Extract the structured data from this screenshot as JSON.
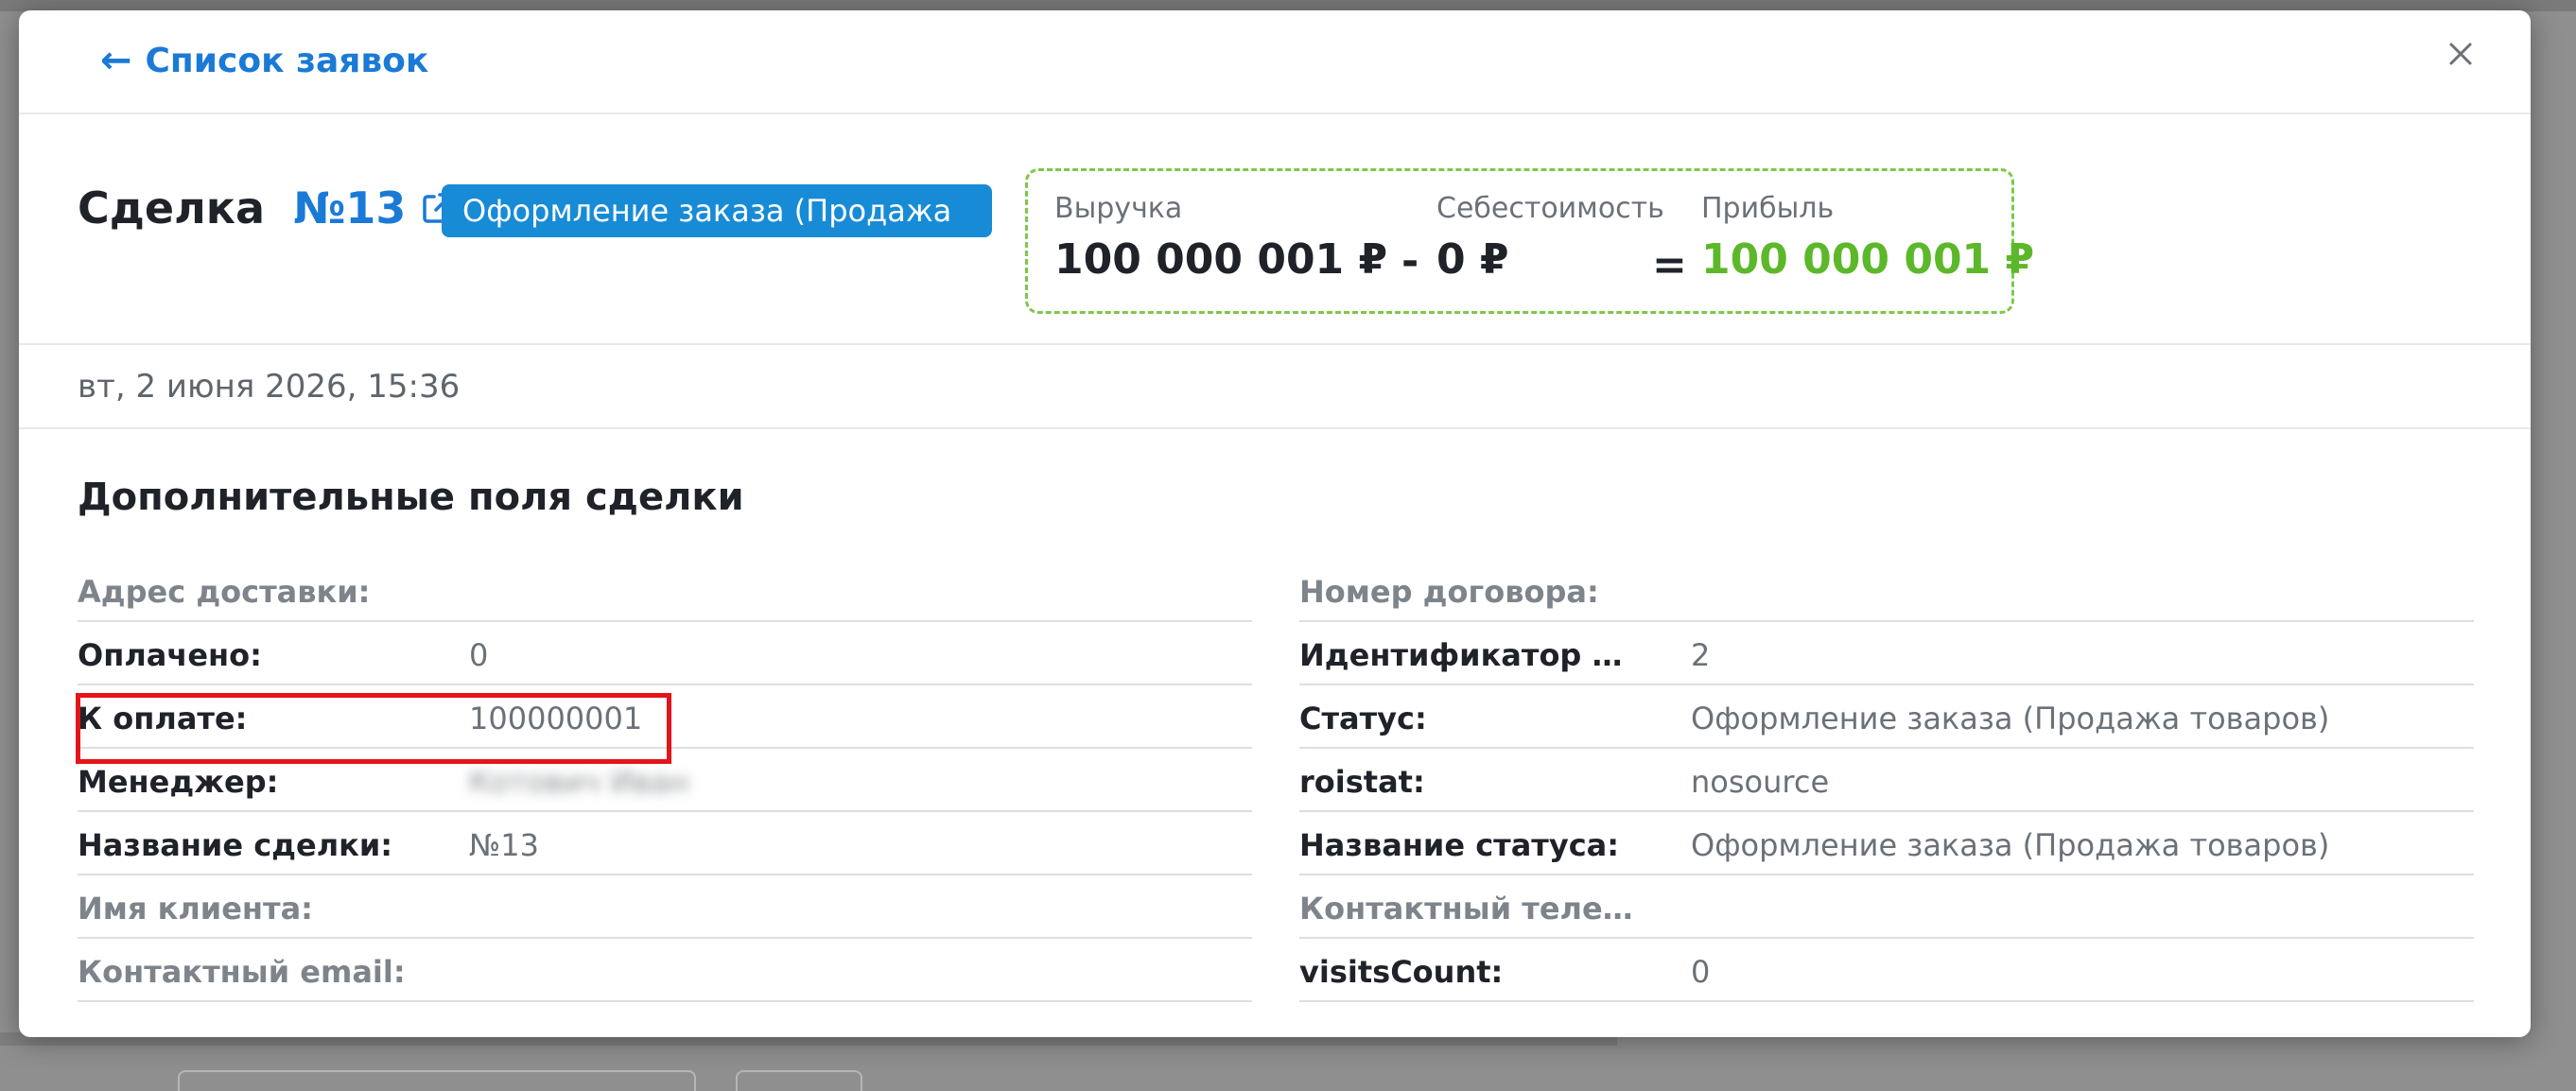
{
  "nav": {
    "back_label": "Список заявок"
  },
  "deal": {
    "title": "Сделка",
    "number": "№13",
    "status_badge": "Оформление заказа (Продажа"
  },
  "finance": {
    "revenue_label": "Выручка",
    "revenue_value": "100 000 001 ₽",
    "minus": "-",
    "cost_label": "Себестоимость",
    "cost_value": "0 ₽",
    "equals": "=",
    "profit_label": "Прибыль",
    "profit_value": "100 000 001 ₽",
    "profit_color": "#5cb82a",
    "border_color": "#7cc84a"
  },
  "date": "вт, 2 июня 2026, 15:36",
  "section_title": "Дополнительные поля сделки",
  "fields_left": [
    {
      "label": "Адрес доставки:",
      "value": "",
      "muted": true
    },
    {
      "label": "Оплачено:",
      "value": "0",
      "muted": false
    },
    {
      "label": "К оплате:",
      "value": "100000001",
      "muted": false,
      "highlighted": true
    },
    {
      "label": "Менеджер:",
      "value": "Котович Иван",
      "muted": false,
      "blurred": true
    },
    {
      "label": "Название сделки:",
      "value": "№13",
      "muted": false
    },
    {
      "label": "Имя клиента:",
      "value": "",
      "muted": true
    },
    {
      "label": "Контактный email:",
      "value": "",
      "muted": true
    }
  ],
  "fields_right": [
    {
      "label": "Номер договора:",
      "value": "",
      "muted": true
    },
    {
      "label": "Идентификатор стат...",
      "value": "2",
      "muted": false
    },
    {
      "label": "Статус:",
      "value": "Оформление заказа (Продажа товаров)",
      "muted": false
    },
    {
      "label": "roistat:",
      "value": "nosource",
      "muted": false
    },
    {
      "label": "Название статуса:",
      "value": "Оформление заказа (Продажа товаров)",
      "muted": false
    },
    {
      "label": "Контактный телефон:",
      "value": "",
      "muted": true
    },
    {
      "label": "visitsCount:",
      "value": "0",
      "muted": false
    }
  ],
  "colors": {
    "accent": "#1a7ad6",
    "badge": "#178bd6",
    "highlight": "#e4141b"
  }
}
